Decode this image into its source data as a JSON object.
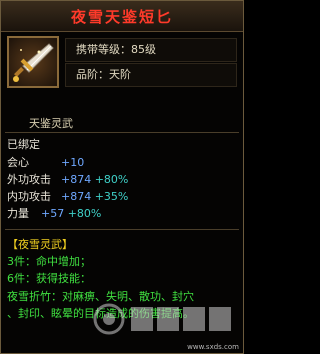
{
  "item": {
    "name": "夜雪天鉴短匕",
    "carry_level": "携带等级：85级",
    "grade": "品阶：天阶",
    "sub_name": "天鉴灵武"
  },
  "status": "已绑定",
  "stats": [
    {
      "label": "会心",
      "base": "+10",
      "bonus": ""
    },
    {
      "label": "外功攻击",
      "base": "+874",
      "bonus": "+80%"
    },
    {
      "label": "内功攻击",
      "base": "+874",
      "bonus": "+35%"
    },
    {
      "label": "力量",
      "base": "+57",
      "bonus": "+80%"
    }
  ],
  "set": {
    "title": "【夜雪灵武】",
    "bonus3": "3件：命中增加；",
    "bonus6": "6件：获得技能：",
    "skill_line1": "夜雪折竹：对麻痹、失明、散功、封穴",
    "skill_line2": "、封印、眩晕的目标造成的伤害提高。"
  },
  "watermark": {
    "url": "www.sxds.com"
  },
  "colors": {
    "title": "#ff3a2a",
    "stat_base": "#6fa8ff",
    "stat_bonus": "#3fd0c8",
    "set_title": "#f0d020",
    "set_text": "#40e040"
  }
}
